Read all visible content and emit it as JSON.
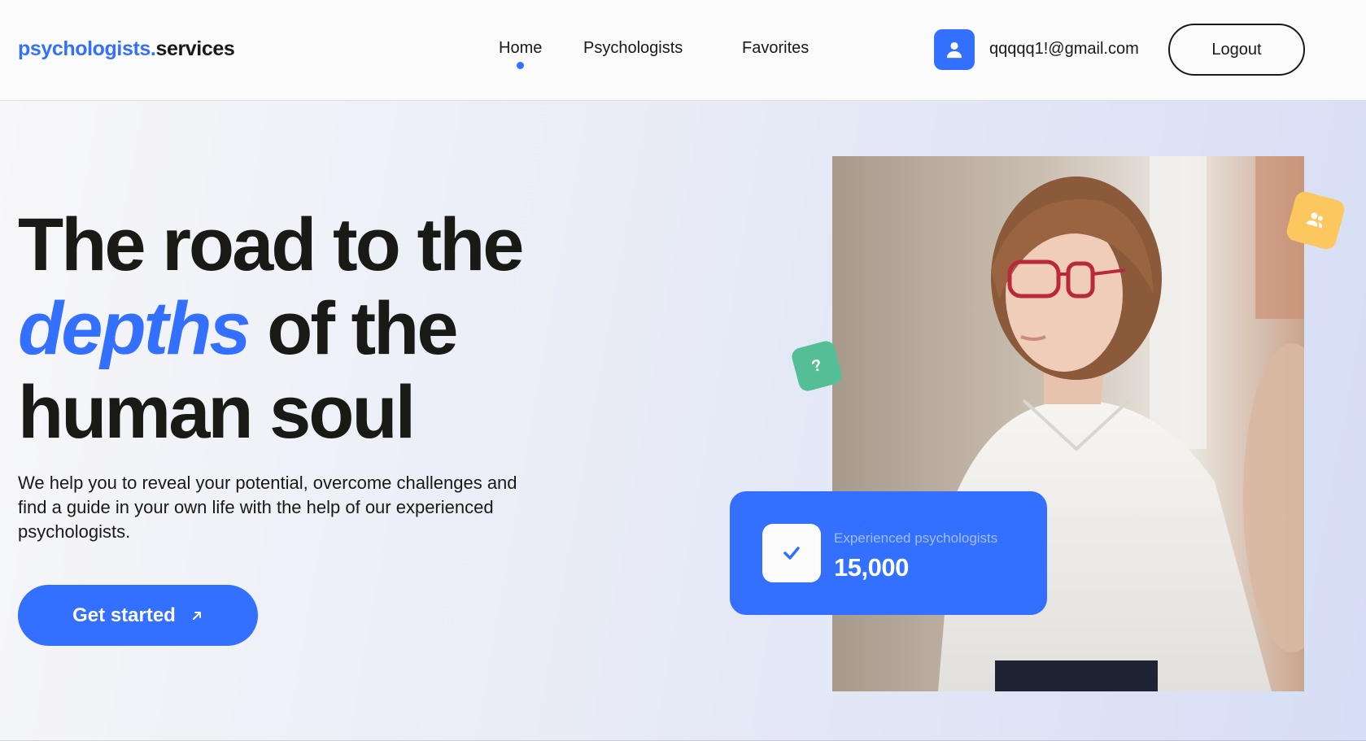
{
  "brand": {
    "accent": "psychologists.",
    "rest": "services",
    "accent_color": "#3470ff"
  },
  "nav": {
    "items": [
      {
        "label": "Home",
        "active": true
      },
      {
        "label": "Psychologists",
        "active": false
      },
      {
        "label": "Favorites",
        "active": false
      }
    ]
  },
  "user": {
    "avatar_icon": "user-icon",
    "email": "qqqqq1!@gmail.com",
    "logout_label": "Logout"
  },
  "hero": {
    "title_line1": "The road to the",
    "title_em": "depths",
    "title_line2_rest": " of the",
    "title_line3": "human soul",
    "subtitle": "We help you to reveal your potential, overcome challenges and find a guide in your own life with the help of our experienced psychologists.",
    "cta_label": "Get started",
    "cta_icon": "arrow-up-right-icon"
  },
  "stats": {
    "label": "Experienced psychologists",
    "value": "15,000",
    "icon": "check-icon"
  },
  "decorations": {
    "yellow_badge_icon": "users-icon",
    "green_badge_text": "?"
  },
  "colors": {
    "primary": "#3470ff",
    "text": "#191a15",
    "yellow": "#fbc75e",
    "green": "#54be96"
  }
}
